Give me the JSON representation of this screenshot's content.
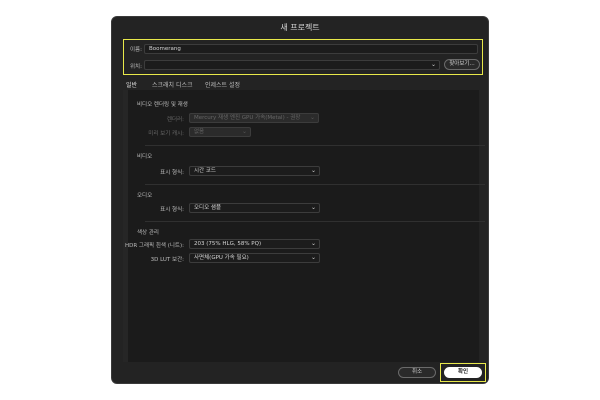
{
  "dialog": {
    "title": "새 프로젝트",
    "name_label": "이름:",
    "name_value": "Boomerang",
    "location_label": "위치:",
    "location_value": "",
    "browse_button": "찾아보기...",
    "tabs": [
      {
        "label": "일반",
        "active": true
      },
      {
        "label": "스크래치 디스크",
        "active": false
      },
      {
        "label": "인제스트 설정",
        "active": false
      }
    ],
    "sections": {
      "video_rendering": {
        "title": "비디오 렌더링 및 재생",
        "renderer_label": "렌더러:",
        "renderer_value": "Mercury 재생 엔진 GPU 가속(Metal) - 권장",
        "preview_cache_label": "미리 보기 캐시:",
        "preview_cache_value": "없음"
      },
      "video": {
        "title": "비디오",
        "display_format_label": "표시 형식:",
        "display_format_value": "시간 코드"
      },
      "audio": {
        "title": "오디오",
        "display_format_label": "표시 형식:",
        "display_format_value": "오디오 샘플"
      },
      "color": {
        "title": "색상 관리",
        "hdr_label": "HDR 그래픽 흰색 (니트):",
        "hdr_value": "203 (75% HLG, 58% PQ)",
        "lut_label": "3D LUT 보간:",
        "lut_value": "사면체(GPU 가속 필요)"
      }
    },
    "cancel_button": "취소",
    "ok_button": "확인"
  },
  "colors": {
    "dialog_bg": "#232323",
    "highlight": "#e8e84a",
    "primary_button": "#ffffff"
  }
}
